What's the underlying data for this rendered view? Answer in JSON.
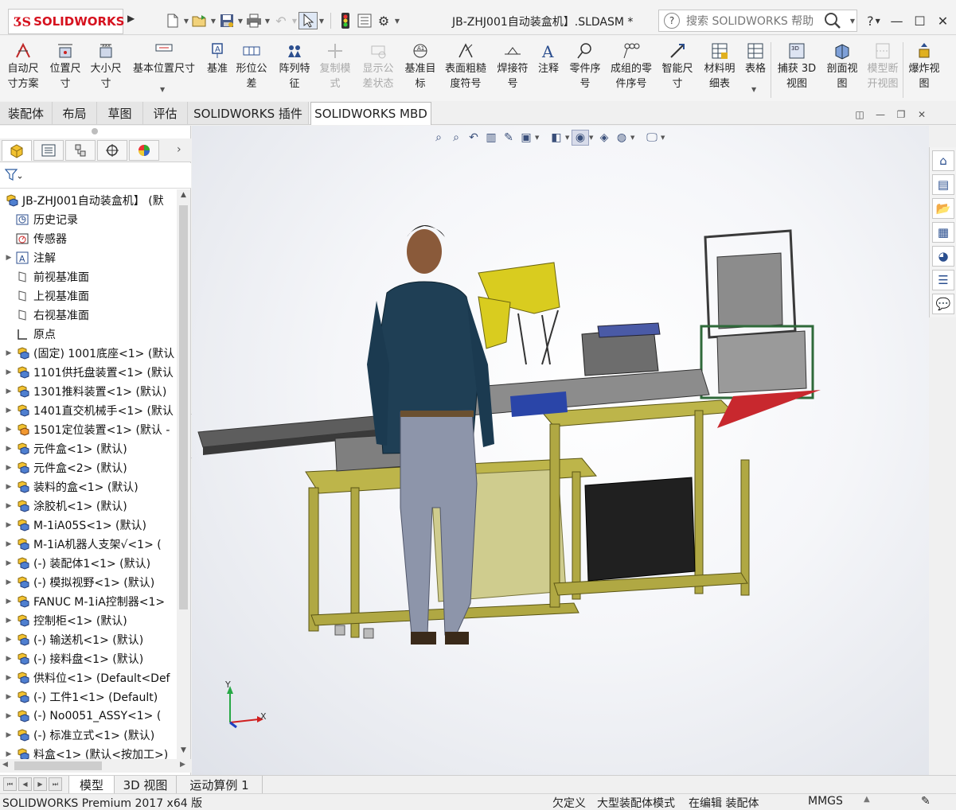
{
  "app": {
    "brand": "SOLIDWORKS",
    "document_title": "JB-ZHJ001自动装盒机】.SLDASM *",
    "search_placeholder": "搜索 SOLIDWORKS 帮助",
    "help_label": "?"
  },
  "ribbon": {
    "buttons": [
      {
        "label": "自动尺\n寸方案",
        "icon": "auto-dimension-icon",
        "enabled": true
      },
      {
        "label": "位置尺\n寸",
        "icon": "location-dimension-icon",
        "enabled": true
      },
      {
        "label": "大小尺\n寸",
        "icon": "size-dimension-icon",
        "enabled": true
      },
      {
        "label": "基本位置尺寸",
        "icon": "basic-location-dimension-icon",
        "enabled": true
      },
      {
        "label": "基准",
        "icon": "datum-icon",
        "enabled": true
      },
      {
        "label": "形位公\n差",
        "icon": "geometric-tolerance-icon",
        "enabled": true
      },
      {
        "label": "阵列特\n征",
        "icon": "pattern-feature-icon",
        "enabled": true
      },
      {
        "label": "复制模\n式",
        "icon": "copy-scheme-icon",
        "enabled": false
      },
      {
        "label": "显示公\n差状态",
        "icon": "show-tolerance-status-icon",
        "enabled": false
      },
      {
        "label": "基准目\n标",
        "icon": "datum-target-icon",
        "enabled": true
      },
      {
        "label": "表面粗糙\n度符号",
        "icon": "surface-finish-icon",
        "enabled": true
      },
      {
        "label": "焊接符\n号",
        "icon": "weld-symbol-icon",
        "enabled": true
      },
      {
        "label": "注释",
        "icon": "note-icon",
        "enabled": true
      },
      {
        "label": "零件序\n号",
        "icon": "balloon-icon",
        "enabled": true
      },
      {
        "label": "成组的零\n件序号",
        "icon": "stacked-balloon-icon",
        "enabled": true
      },
      {
        "label": "智能尺\n寸",
        "icon": "smart-dimension-icon",
        "enabled": true
      },
      {
        "label": "材料明\n细表",
        "icon": "bill-of-materials-icon",
        "enabled": true
      },
      {
        "label": "表格",
        "icon": "table-icon",
        "enabled": true
      },
      {
        "label": "捕获 3D\n视图",
        "icon": "capture-3d-view-icon",
        "enabled": true
      },
      {
        "label": "剖面视\n图",
        "icon": "section-view-icon",
        "enabled": true
      },
      {
        "label": "模型断\n开视图",
        "icon": "model-break-view-icon",
        "enabled": false
      },
      {
        "label": "爆炸视\n图",
        "icon": "exploded-view-icon",
        "enabled": true
      }
    ]
  },
  "command_tabs": [
    {
      "label": "装配体",
      "active": false
    },
    {
      "label": "布局",
      "active": false
    },
    {
      "label": "草图",
      "active": false
    },
    {
      "label": "评估",
      "active": false
    },
    {
      "label": "SOLIDWORKS 插件",
      "active": false
    },
    {
      "label": "SOLIDWORKS MBD",
      "active": true
    }
  ],
  "tree": {
    "root": "JB-ZHJ001自动装盒机】 (默",
    "items": [
      {
        "label": "历史记录",
        "icon": "history-icon",
        "expandable": false
      },
      {
        "label": "传感器",
        "icon": "sensor-icon",
        "expandable": false
      },
      {
        "label": "注解",
        "icon": "annotation-icon",
        "expandable": true
      },
      {
        "label": "前视基准面",
        "icon": "plane-icon",
        "expandable": false
      },
      {
        "label": "上视基准面",
        "icon": "plane-icon",
        "expandable": false
      },
      {
        "label": "右视基准面",
        "icon": "plane-icon",
        "expandable": false
      },
      {
        "label": "原点",
        "icon": "origin-icon",
        "expandable": false
      },
      {
        "label": "(固定) 1001底座<1> (默认",
        "icon": "assembly-icon",
        "expandable": true
      },
      {
        "label": "1101供托盘装置<1> (默认",
        "icon": "assembly-icon",
        "expandable": true
      },
      {
        "label": "1301推料装置<1> (默认)",
        "icon": "assembly-icon",
        "expandable": true
      },
      {
        "label": "1401直交机械手<1> (默认",
        "icon": "assembly-icon",
        "expandable": true
      },
      {
        "label": "1501定位装置<1> (默认 -",
        "icon": "assembly-flexible-icon",
        "expandable": true
      },
      {
        "label": "元件盒<1> (默认)",
        "icon": "assembly-icon",
        "expandable": true
      },
      {
        "label": "元件盒<2> (默认)",
        "icon": "assembly-icon",
        "expandable": true
      },
      {
        "label": "装料的盒<1> (默认)",
        "icon": "assembly-icon",
        "expandable": true
      },
      {
        "label": "涂胶机<1> (默认)",
        "icon": "assembly-icon",
        "expandable": true
      },
      {
        "label": "M-1iA05S<1> (默认)",
        "icon": "assembly-icon",
        "expandable": true
      },
      {
        "label": "M-1iA机器人支架√<1> (",
        "icon": "assembly-icon",
        "expandable": true
      },
      {
        "label": "(-) 装配体1<1> (默认)",
        "icon": "assembly-icon",
        "expandable": true
      },
      {
        "label": "(-) 模拟视野<1> (默认)",
        "icon": "assembly-icon",
        "expandable": true
      },
      {
        "label": "FANUC M-1iA控制器<1>",
        "icon": "assembly-icon",
        "expandable": true
      },
      {
        "label": "控制柜<1> (默认)",
        "icon": "assembly-icon",
        "expandable": true
      },
      {
        "label": "(-) 输送机<1> (默认)",
        "icon": "assembly-icon",
        "expandable": true
      },
      {
        "label": "(-) 接料盘<1> (默认)",
        "icon": "assembly-icon",
        "expandable": true
      },
      {
        "label": "供料位<1> (Default<Def",
        "icon": "assembly-icon",
        "expandable": true
      },
      {
        "label": "(-) 工件1<1> (Default)",
        "icon": "assembly-icon",
        "expandable": true
      },
      {
        "label": "(-) No0051_ASSY<1> (",
        "icon": "assembly-icon",
        "expandable": true
      },
      {
        "label": "(-) 标准立式<1> (默认)",
        "icon": "assembly-icon",
        "expandable": true
      },
      {
        "label": "料盒<1> (默认<按加工>)",
        "icon": "assembly-icon",
        "expandable": true
      }
    ]
  },
  "viewport": {
    "triad": {
      "x": "X",
      "y": "Y"
    }
  },
  "bottom_tabs": [
    {
      "label": "模型",
      "active": true
    },
    {
      "label": "3D 视图",
      "active": false
    },
    {
      "label": "运动算例 1",
      "active": false
    }
  ],
  "status": {
    "product": "SOLIDWORKS Premium 2017 x64 版",
    "definition": "欠定义",
    "mode": "大型装配体模式",
    "editing": "在编辑 装配体",
    "units": "MMGS"
  },
  "colors": {
    "brand_red": "#d6121f",
    "frame_olive": "#bdb54a",
    "robot_yellow": "#d9cc1f"
  }
}
